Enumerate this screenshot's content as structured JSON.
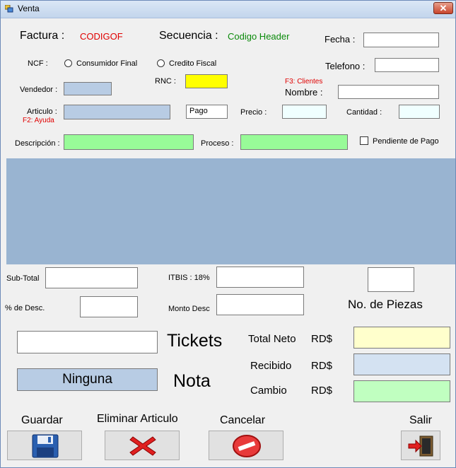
{
  "window": {
    "title": "Venta",
    "close_glyph": "✕"
  },
  "header": {
    "factura_label": "Factura :",
    "factura_value": "CODIGOF",
    "secuencia_label": "Secuencia :",
    "secuencia_value": "Codigo Header",
    "fecha_label": "Fecha :",
    "telefono_label": "Telefono :",
    "nombre_label": "Nombre :",
    "clientes_hint": "F3: Clientes"
  },
  "ncf": {
    "label": "NCF :",
    "option_consumidor": "Consumidor Final",
    "option_credito": "Credito Fiscal"
  },
  "rnc_label": "RNC :",
  "vendedor_label": "Vendedor :",
  "articulo": {
    "label": "Articulo :",
    "hint": "F2: Ayuda",
    "pago_value": "Pago",
    "precio_label": "Precio :",
    "cantidad_label": "Cantidad :"
  },
  "descripcion_label": "Descripción :",
  "proceso_label": "Proceso :",
  "pendiente_label": "Pendiente de Pago",
  "totals": {
    "subtotal_label": "Sub-Total",
    "itbis_label": "ITBIS : 18%",
    "desc_label": "% de Desc.",
    "monto_desc_label": "Monto Desc",
    "piezas_label": "No. de  Piezas"
  },
  "summary": {
    "tickets_label": "Tickets",
    "nota_label": "Nota",
    "nota_value": "Ninguna",
    "total_neto_label": "Total Neto",
    "recibido_label": "Recibido",
    "cambio_label": "Cambio",
    "currency": "RD$"
  },
  "actions": {
    "guardar": "Guardar",
    "eliminar": "Eliminar Articulo",
    "cancelar": "Cancelar",
    "salir": "Salir"
  },
  "icons": {
    "save": "floppy-disk-icon",
    "delete": "red-x-icon",
    "cancel": "no-entry-icon",
    "exit": "exit-door-icon"
  }
}
